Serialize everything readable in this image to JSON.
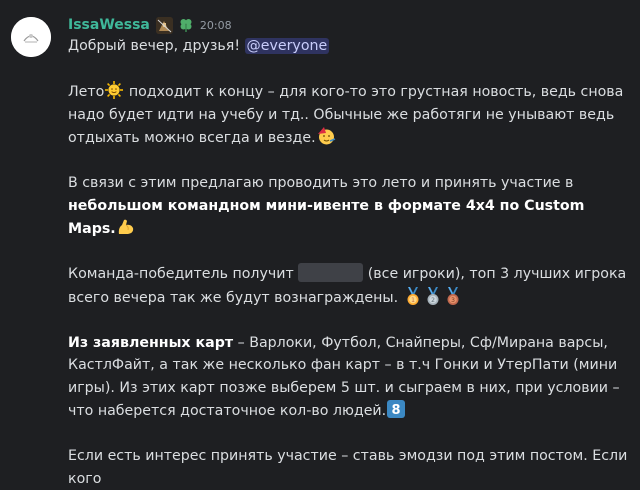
{
  "message": {
    "username": "IssaWessa",
    "timestamp": "20:08",
    "role_icon": "game-character-icon",
    "badge_icon": "clover-icon",
    "greeting": "Добрый вечер, друзья!",
    "mention": "@everyone",
    "p1_a": "Лето",
    "p1_b": " подходит к концу – для кого-то это грустная новость, ведь снова надо будет идти на учебу и тд.. Обычные же работяги не унывают ведь отдыхать можно всегда и везде.",
    "p2_a": "В связи с этим предлагаю проводить это лето и принять участие в ",
    "p2_bold": "небольшом командном мини-ивенте в формате 4х4 по Custom Maps.",
    "p3_a": "Команда-победитель получит ",
    "p3_b": " (все игроки), топ 3 лучших игрока всего вечера так же будут вознаграждены.",
    "p4_bold": "Из заявленных карт",
    "p4_b": " – Варлоки, Футбол, Снайперы, Сф/Мирана варсы, КастлФайт, а так же несколько фан карт – в т.ч Гонки и УтерПати (мини игры). Из этих карт позже выберем 5 шт. и сыграем в них, при условии – что наберется достаточное кол-во людей.",
    "p5": "Если есть интерес принять участие – ставь эмодзи под этим постом. Если кого",
    "emojis": {
      "sun": "sun-with-face-icon",
      "party": "partying-face-icon",
      "muscle": "flexed-biceps-icon",
      "medals": [
        "1st-place-medal-icon",
        "2nd-place-medal-icon",
        "3rd-place-medal-icon"
      ],
      "keycap": "8"
    },
    "colors": {
      "background": "#1e1f22",
      "username": "#3fb89a",
      "text": "#dbdee1",
      "timestamp": "#949ba4",
      "mention_bg": "#3c4270",
      "keycap": "#3b88c3"
    }
  }
}
